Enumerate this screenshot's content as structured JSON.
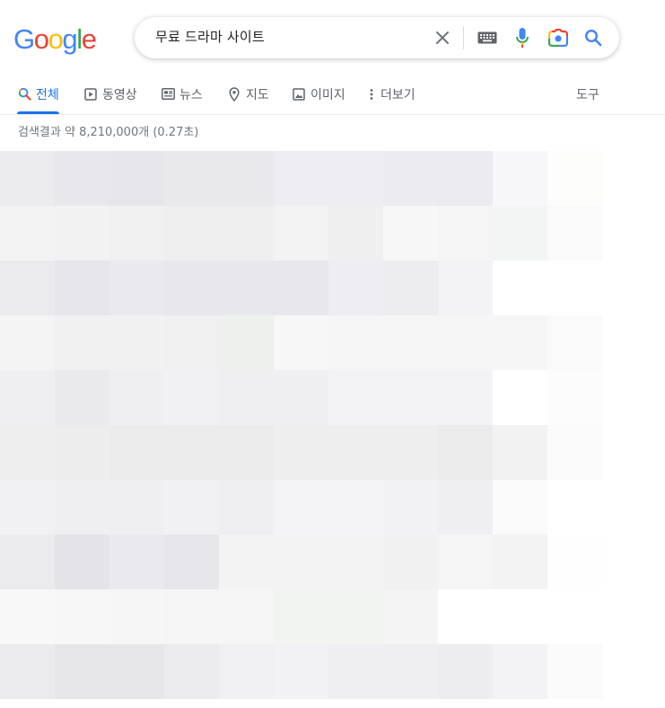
{
  "logo": {
    "text": "Google",
    "letters": [
      {
        "ch": "G",
        "color": "#4285f4"
      },
      {
        "ch": "o",
        "color": "#ea4335"
      },
      {
        "ch": "o",
        "color": "#fbbc05"
      },
      {
        "ch": "g",
        "color": "#4285f4"
      },
      {
        "ch": "l",
        "color": "#34a853"
      },
      {
        "ch": "e",
        "color": "#ea4335"
      }
    ]
  },
  "search": {
    "query": "무료 드라마 사이트"
  },
  "tabs": [
    {
      "label": "전체",
      "icon": "search-icon",
      "active": true
    },
    {
      "label": "동영상",
      "icon": "video-icon"
    },
    {
      "label": "뉴스",
      "icon": "news-icon"
    },
    {
      "label": "지도",
      "icon": "map-pin-icon"
    },
    {
      "label": "이미지",
      "icon": "image-icon"
    },
    {
      "label": "더보기",
      "icon": "more-vert-icon"
    }
  ],
  "tools_label": "도구",
  "result_stats": "검색결과 약 8,210,000개 (0.27초)",
  "colors": {
    "accent": "#1a73e8",
    "muted": "#5f6368"
  },
  "mosaic_rows": [
    [
      "#ebebee",
      "#e8e8ec",
      "#e6e6eb",
      "#e9e9ec",
      "#e9e9ec",
      "#eeeef2",
      "#eeeef2",
      "#ececf0",
      "#eaeaef",
      "#f7f7fa",
      "#fdfdfb"
    ],
    [
      "#f3f3f3",
      "#f2f2f2",
      "#f0f0f0",
      "#efefef",
      "#efefef",
      "#f3f3f3",
      "#efefef",
      "#f7f7f7",
      "#f5f5f5",
      "#f3f5f5",
      "#fafafa"
    ],
    [
      "#ebebee",
      "#e6e6ea",
      "#eaeaee",
      "#e8e8ec",
      "#e8e8ec",
      "#e8e8ec",
      "#eeeef2",
      "#ededf0",
      "#f3f3f6",
      "#ffffff",
      "#ffffff"
    ],
    [
      "#f4f4f4",
      "#f1f1f1",
      "#f1f1f1",
      "#f0f0f0",
      "#eef0ee",
      "#f7f7f7",
      "#f5f5f5",
      "#f5f5f5",
      "#f5f5f5",
      "#f5f5f5",
      "#fafafa"
    ],
    [
      "#efeff2",
      "#eaeaed",
      "#efeff2",
      "#f1f1f3",
      "#efeff2",
      "#efeff2",
      "#f3f3f5",
      "#f3f3f5",
      "#f3f3f5",
      "#ffffff",
      "#fcfcfc"
    ],
    [
      "#eeeeee",
      "#ededed",
      "#ebebeb",
      "#ebebeb",
      "#ebebeb",
      "#eeeeee",
      "#eeeeee",
      "#eeeeee",
      "#ebebeb",
      "#f2f2f2",
      "#fafafa"
    ],
    [
      "#f1f1f3",
      "#efeff2",
      "#efeff2",
      "#f1f1f3",
      "#efeff2",
      "#f4f4f6",
      "#f4f4f6",
      "#f2f2f4",
      "#efeff2",
      "#fafafa",
      "#ffffff"
    ],
    [
      "#ebebee",
      "#e4e4e8",
      "#eaeaee",
      "#e6e6ea",
      "#f3f3f3",
      "#f3f3f3",
      "#f3f3f3",
      "#f1f1f1",
      "#f5f5f5",
      "#f3f3f3",
      "#fefefe"
    ],
    [
      "#f8f8f8",
      "#f6f7f6",
      "#f5f6f5",
      "#f4f5f4",
      "#f4f5f4",
      "#f2f4f2",
      "#f2f4f2",
      "#f3f4f3",
      "#ffffff",
      "#ffffff",
      "#ffffff"
    ],
    [
      "#ebebee",
      "#e6e6e9",
      "#e6e6e9",
      "#ebebee",
      "#f0f0f3",
      "#f2f2f4",
      "#efeff2",
      "#efeff2",
      "#ededf0",
      "#f3f3f6",
      "#fbfbfb"
    ]
  ]
}
